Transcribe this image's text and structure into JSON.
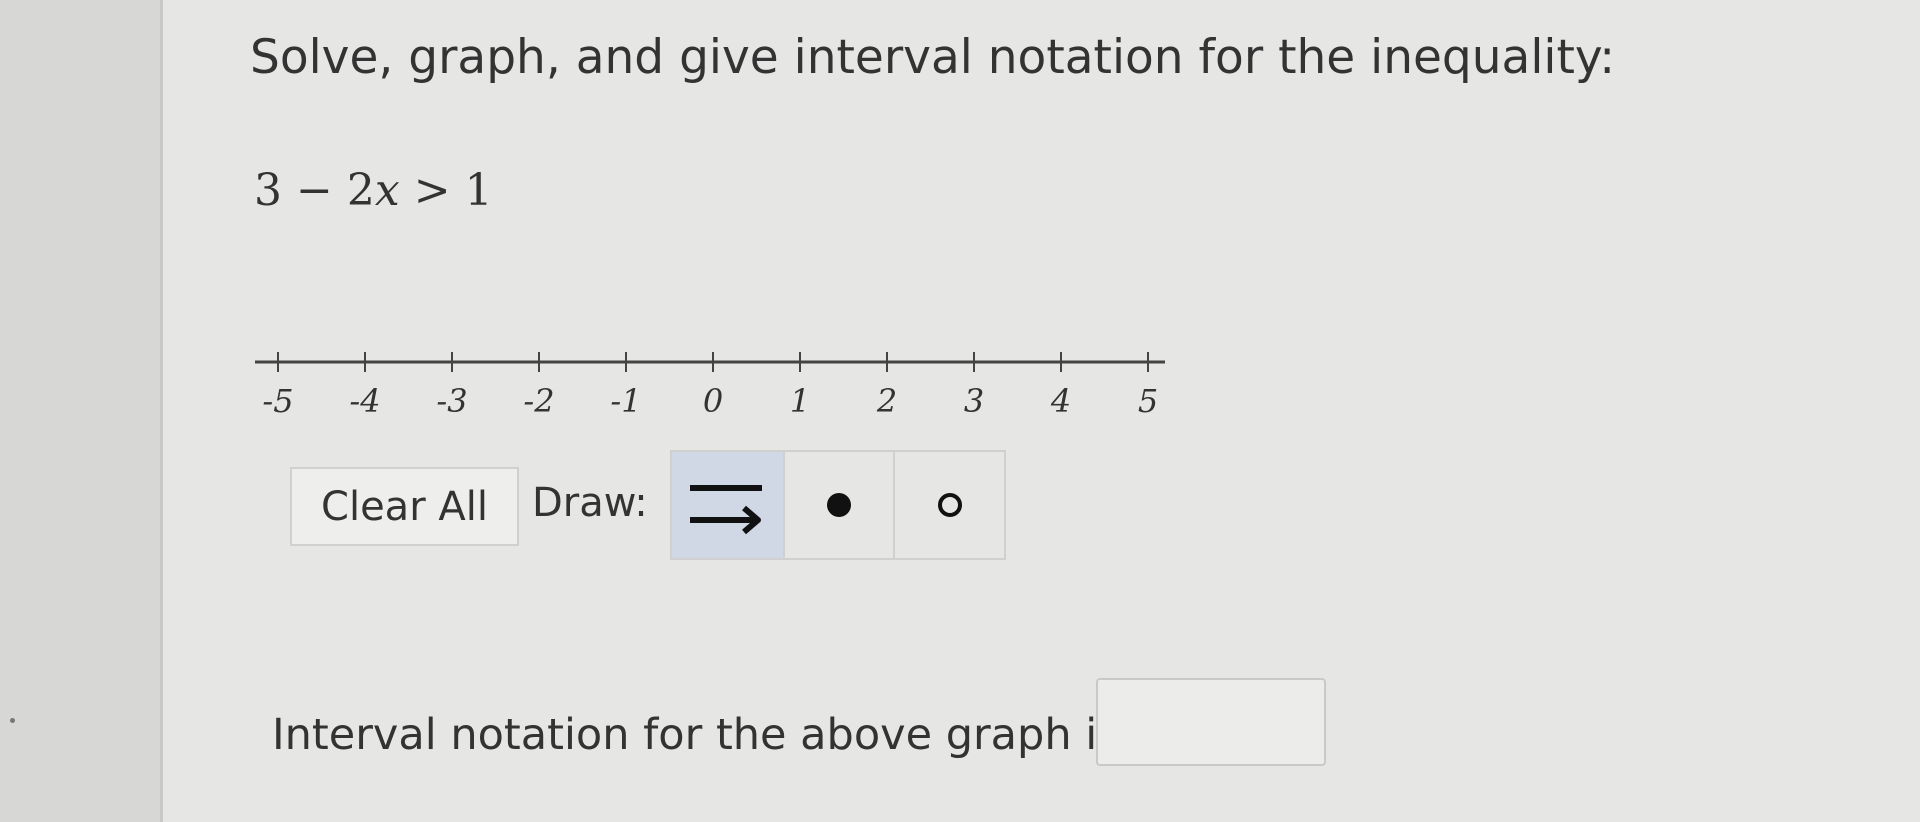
{
  "question": {
    "prompt": "Solve, graph, and give interval notation for the inequality:",
    "equation": {
      "lhs_const": "3",
      "op1": "−",
      "coef": "2",
      "variable": "x",
      "relation": ">",
      "rhs": "1"
    }
  },
  "number_line": {
    "min": -5,
    "max": 5,
    "tick_labels": [
      "-5",
      "-4",
      "-3",
      "-2",
      "-1",
      "0",
      "1",
      "2",
      "3",
      "4",
      "5"
    ]
  },
  "toolbar": {
    "clear_label": "Clear All",
    "draw_label": "Draw:",
    "tools": [
      {
        "name": "ray-tool",
        "icon": "ray-arrow-icon",
        "selected": true
      },
      {
        "name": "closed-dot-tool",
        "icon": "filled-circle-icon",
        "selected": false
      },
      {
        "name": "open-dot-tool",
        "icon": "open-circle-icon",
        "selected": false
      }
    ]
  },
  "answer": {
    "label": "Interval notation for the above graph is",
    "value": ""
  },
  "colors": {
    "background": "#e6e7e5",
    "selected_tool": "#cfd8e4",
    "text": "#333333"
  }
}
